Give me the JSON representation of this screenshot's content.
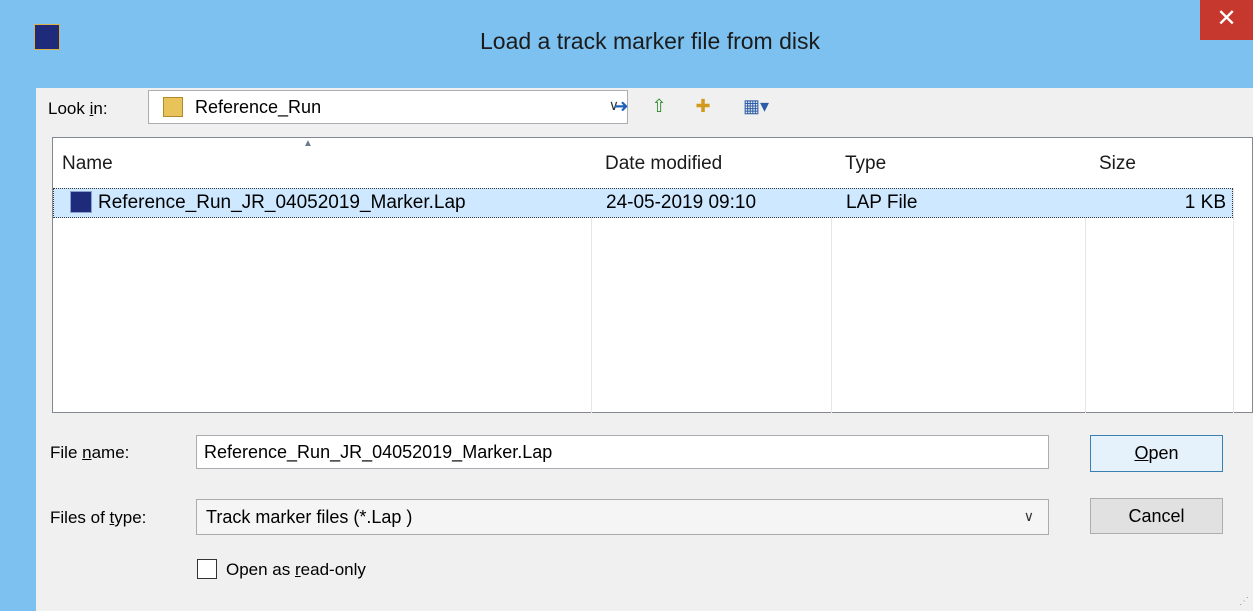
{
  "window": {
    "title": "Load a track marker file from disk",
    "close_glyph": "✕"
  },
  "lookin": {
    "label_prefix": "Look ",
    "label_accel": "i",
    "label_suffix": "n:",
    "value": "Reference_Run",
    "dropdown_glyph": "∨"
  },
  "toolbar": {
    "back_glyph": "➜",
    "up_glyph": "⇧",
    "new_folder_glyph": "✚",
    "view_glyph": "▦▾"
  },
  "columns": {
    "name": "Name",
    "date": "Date modified",
    "type": "Type",
    "size": "Size",
    "sort_glyph": "▲"
  },
  "files": [
    {
      "name": "Reference_Run_JR_04052019_Marker.Lap",
      "date": "24-05-2019 09:10",
      "type": "LAP File",
      "size": "1 KB"
    }
  ],
  "filename": {
    "label_prefix": "File ",
    "label_accel": "n",
    "label_suffix": "ame:",
    "value": "Reference_Run_JR_04052019_Marker.Lap"
  },
  "filetype": {
    "label_prefix": "Files of ",
    "label_accel": "t",
    "label_suffix": "ype:",
    "value": "Track marker files (*.Lap )",
    "dropdown_glyph": "∨"
  },
  "buttons": {
    "open_accel": "O",
    "open_rest": "pen",
    "cancel": "Cancel"
  },
  "readonly": {
    "label_prefix": "Open as ",
    "label_accel": "r",
    "label_suffix": "ead-only",
    "checked": false
  },
  "colors": {
    "titlebar": "#7cc1ef",
    "close": "#c6382d",
    "selection": "#cde8ff"
  }
}
